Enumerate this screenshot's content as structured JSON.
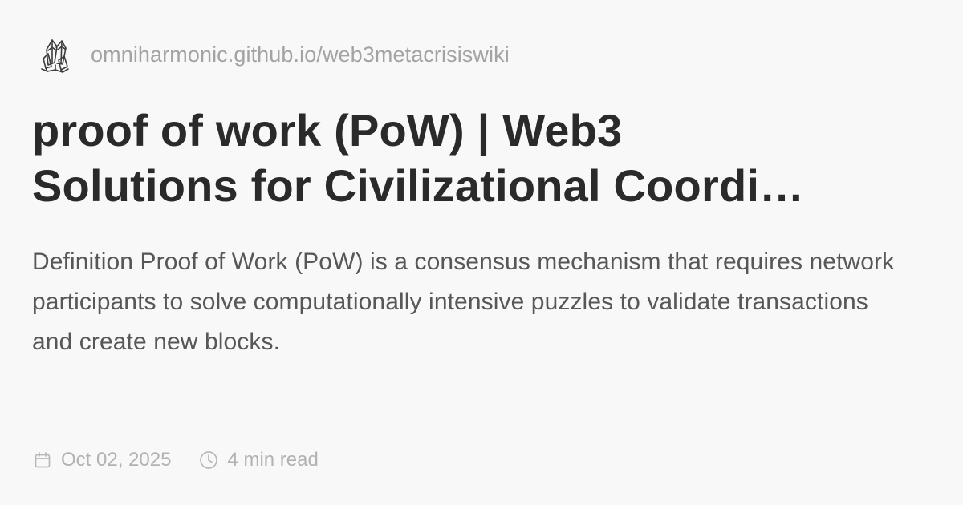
{
  "site": {
    "logo_icon": "crystal-cluster-logo-icon",
    "url": "omniharmonic.github.io/web3metacrisiswiki"
  },
  "article": {
    "title_line1": "proof of work (PoW) | Web3",
    "title_line2": "Solutions for Civilizational Coordi…",
    "description": "Definition Proof of Work (PoW) is a consensus mechanism that requires network participants to solve computationally intensive puzzles to validate transactions and create new blocks."
  },
  "meta": {
    "date_icon": "calendar-icon",
    "date": "Oct 02, 2025",
    "read_time_icon": "clock-icon",
    "read_time": "4 min read"
  },
  "colors": {
    "background": "#f9f8f9",
    "title": "#2b2a2b",
    "description": "#575658",
    "muted": "#a3a2a4",
    "divider": "#e7e5e7"
  }
}
